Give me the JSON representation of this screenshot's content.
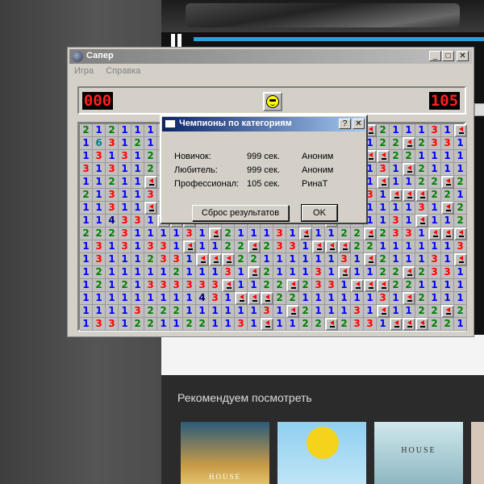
{
  "window": {
    "title": "Сапер",
    "controls": {
      "minimize": "_",
      "maximize": "□",
      "close": "✕"
    }
  },
  "menu": [
    "Игра",
    "Справка"
  ],
  "game": {
    "mines_counter": "000",
    "timer": "105",
    "face_icon": "smiley-sunglasses-icon",
    "board": [
      "212111",
      "1631",
      "13131",
      "3131",
      "11211",
      "2131",
      "11311",
      "11433",
      "22231",
      "13131331",
      "131112",
      "12111112",
      "12121333333",
      "1111111114",
      "1111322",
      "1331221122"
    ]
  },
  "dialog": {
    "title": "Чемпионы по категориям",
    "help_button": "?",
    "close_button": "✕",
    "rows": [
      {
        "category": "Новичок:",
        "time": "999 сек.",
        "name": "Аноним"
      },
      {
        "category": "Любитель:",
        "time": "999 сек.",
        "name": "Аноним"
      },
      {
        "category": "Профессионал:",
        "time": "105 сек.",
        "name": "РинаТ"
      }
    ],
    "reset_button": "Сброс результатов",
    "ok_button": "OK"
  },
  "background": {
    "recommend_title": "Рекомендуем посмотреть",
    "thumbnails": [
      "HOUSE",
      "",
      "HOUSE",
      ""
    ]
  }
}
